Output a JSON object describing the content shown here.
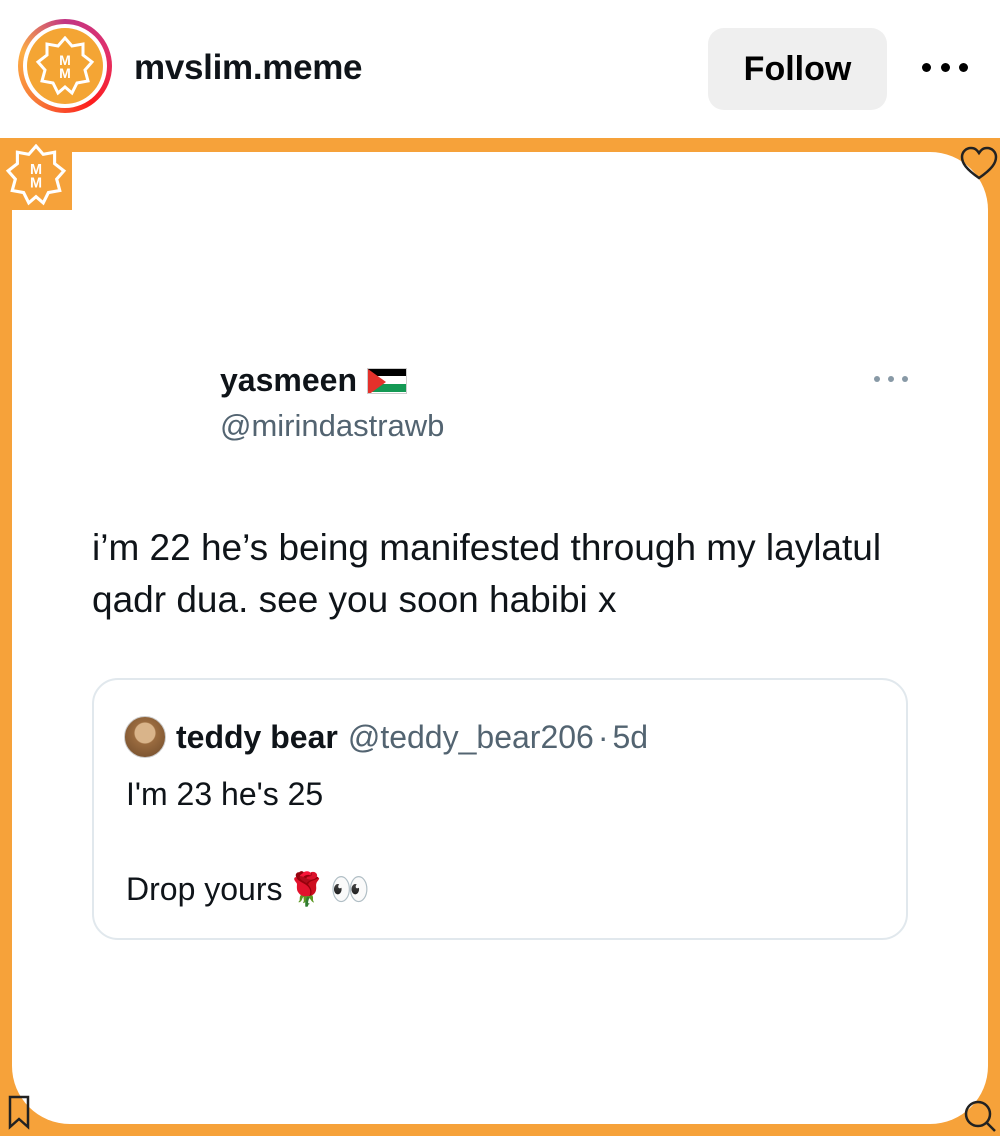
{
  "header": {
    "account_name": "mvslim.meme",
    "follow_label": "Follow",
    "logo_text": "M M"
  },
  "post": {
    "tweet": {
      "display_name": "yasmeen",
      "handle": "@mirindastrawb",
      "text": "i’m 22 he’s being manifested through my laylatul qadr dua. see you soon habibi x"
    },
    "quote": {
      "display_name": "teddy bear",
      "handle": "@teddy_bear206",
      "separator": "·",
      "age": "5d",
      "line1": "I'm 23 he's 25",
      "line2": "Drop yours",
      "emoji_rose": "🌹",
      "emoji_eyes": "👀"
    }
  },
  "colors": {
    "frame_orange": "#f6a23a",
    "follow_bg": "#efefef",
    "muted_text": "#536471"
  },
  "icons": [
    "brand-logo-icon",
    "more-dots-icon",
    "heart-icon",
    "bookmark-icon",
    "search-icon",
    "palestine-flag-icon"
  ]
}
